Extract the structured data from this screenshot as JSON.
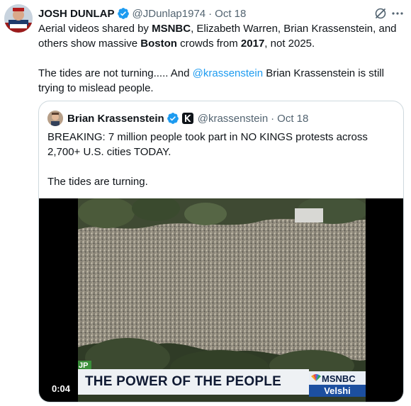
{
  "tweet": {
    "author_name": "JOSH DUNLAP",
    "handle": "@JDunlap1974",
    "separator": "·",
    "time": "Oct 18",
    "text": {
      "l1_a": "Aerial videos shared by ",
      "l1_b": "MSNBC",
      "l1_c": ", Elizabeth Warren, Brian Krassenstein, and others show massive ",
      "l1_d": "Boston",
      "l1_e": " crowds from ",
      "l1_f": "2017",
      "l1_g": ", not 2025.",
      "l2_a": "The tides are not turning..... And ",
      "l2_mention": "@krassenstein",
      "l2_b": " Brian Krassenstein is still trying to mislead people."
    }
  },
  "quote": {
    "author_name": "Brian Krassenstein",
    "handle": "@krassenstein",
    "separator": "·",
    "time": "Oct 18",
    "para1": "BREAKING: 7 million people took part in NO KINGS protests across 2,700+ U.S. cities TODAY.",
    "para2": "The tides are turning."
  },
  "video": {
    "chyron": "THE POWER OF THE PEOPLE",
    "tag": "JP",
    "network": "MSNBC",
    "show": "Velshi",
    "duration": "0:04"
  },
  "icons": {
    "verified": "verified-badge-icon",
    "grok": "grok-icon",
    "more": "more-options-icon",
    "affiliation": "affiliation-badge-icon"
  },
  "colors": {
    "link": "#1d9bf0",
    "verified": "#1d9bf0",
    "text": "#0f1419",
    "secondary": "#536471"
  }
}
